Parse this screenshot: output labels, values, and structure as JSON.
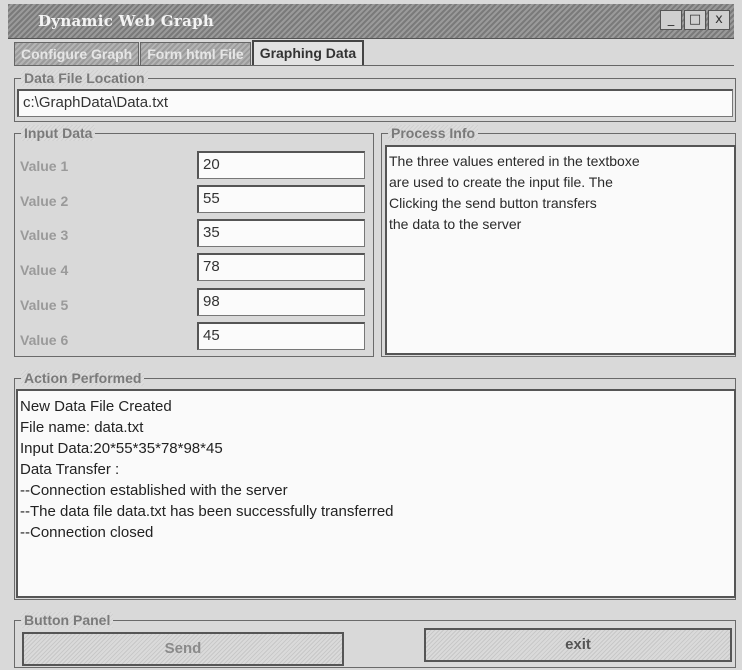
{
  "window": {
    "title": "Dynamic Web Graph",
    "controls": [
      "_",
      "□",
      "x"
    ]
  },
  "tabs": [
    {
      "label": "Configure Graph",
      "active": false
    },
    {
      "label": "Form html File",
      "active": false
    },
    {
      "label": "Graphing Data",
      "active": true
    }
  ],
  "data_file": {
    "legend": "Data File Location",
    "value": "c:\\GraphData\\Data.txt"
  },
  "input_data": {
    "legend": "Input Data",
    "rows": [
      {
        "label": "Value 1",
        "value": "20"
      },
      {
        "label": "Value 2",
        "value": "55"
      },
      {
        "label": "Value 3",
        "value": "35"
      },
      {
        "label": "Value 4",
        "value": "78"
      },
      {
        "label": "Value 5",
        "value": "98"
      },
      {
        "label": "Value 6",
        "value": "45"
      }
    ]
  },
  "process_info": {
    "legend": "Process Info",
    "lines": [
      "The three values entered in the textboxe",
      "are used to create the input file. The",
      "Clicking the send button transfers",
      "the data to the server"
    ]
  },
  "action_performed": {
    "legend": "Action Performed",
    "lines": [
      "New Data File Created",
      "File name: data.txt",
      "Input Data:20*55*35*78*98*45",
      "Data Transfer :",
      "--Connection established with the server",
      "--The data file data.txt has been successfully transferred",
      "--Connection closed"
    ]
  },
  "button_panel": {
    "legend": "Button Panel",
    "send_label": "Send",
    "exit_label": "exit"
  }
}
